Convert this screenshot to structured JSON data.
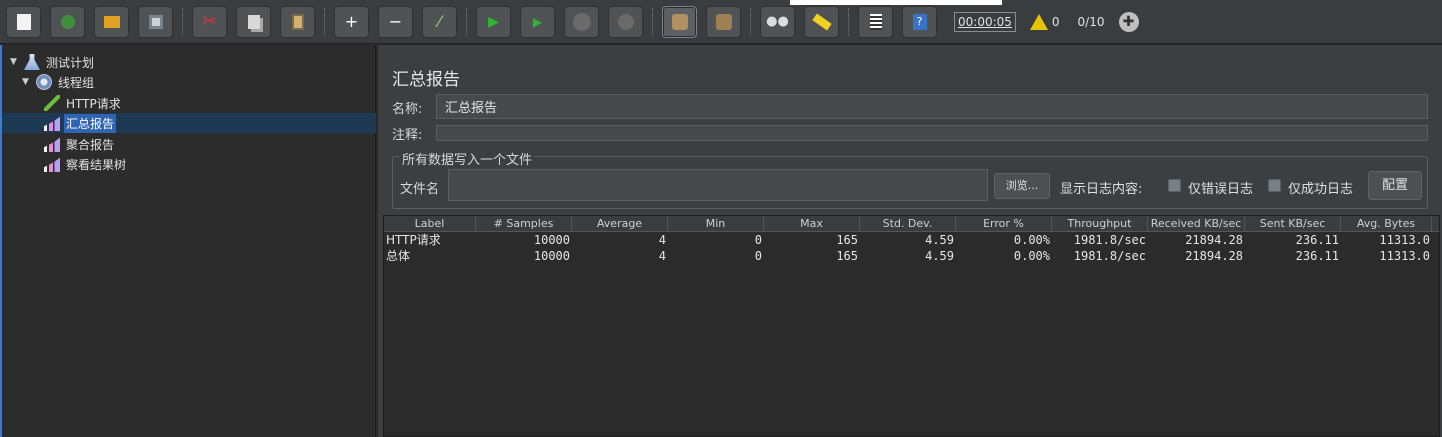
{
  "toolbar": {
    "timer": "00:00:05",
    "warning_count": "0",
    "threads": "0/10"
  },
  "tree": {
    "items": [
      {
        "label": "测试计划"
      },
      {
        "label": "线程组"
      },
      {
        "label": "HTTP请求"
      },
      {
        "label": "汇总报告"
      },
      {
        "label": "聚合报告"
      },
      {
        "label": "察看结果树"
      }
    ]
  },
  "panel": {
    "title": "汇总报告",
    "name_label": "名称:",
    "name_value": "汇总报告",
    "comment_label": "注释:",
    "comment_value": "",
    "file_group_title": "所有数据写入一个文件",
    "filename_label": "文件名",
    "filename_value": "",
    "browse_label": "浏览...",
    "log_content_label": "显示日志内容:",
    "errors_only_label": "仅错误日志",
    "success_only_label": "仅成功日志",
    "configure_label": "配置"
  },
  "table": {
    "headers": [
      "Label",
      "# Samples",
      "Average",
      "Min",
      "Max",
      "Std. Dev.",
      "Error %",
      "Throughput",
      "Received KB/sec",
      "Sent KB/sec",
      "Avg. Bytes"
    ],
    "rows": [
      [
        "HTTP请求",
        "10000",
        "4",
        "0",
        "165",
        "4.59",
        "0.00%",
        "1981.8/sec",
        "21894.28",
        "236.11",
        "11313.0"
      ],
      [
        "总体",
        "10000",
        "4",
        "0",
        "165",
        "4.59",
        "0.00%",
        "1981.8/sec",
        "21894.28",
        "236.11",
        "11313.0"
      ]
    ]
  }
}
